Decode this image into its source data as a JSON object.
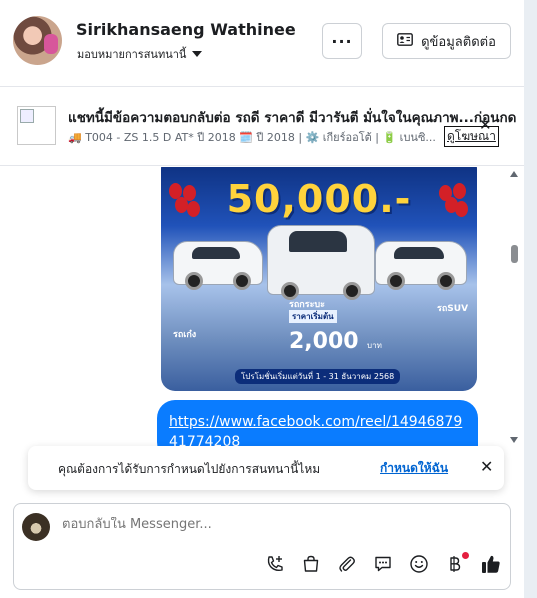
{
  "header": {
    "name": "Sirikhansaeng Wathinee",
    "assign_label": "มอบหมายการสนทนานี้",
    "more_label": "···",
    "contact_label": "ดูข้อมูลติดต่อ"
  },
  "ad": {
    "title": "แชทนี้มีข้อความตอบกลับต่อ รถดี ราคาดี มีวารันตี มั่นใจในคุณภาพ...ก่อนกด",
    "subtitle": "🚚 T004 - ZS 1.5 D AT* ปี 2018 🗓️ ปี 2018 | ⚙️ เกียร์ออโต้ | 🔋 เบนซิ...",
    "view_label": "ดูโฆษณา"
  },
  "image": {
    "price": "50,000.-",
    "cat_left": "รถเก๋ง",
    "cat_center": "รถกระบะ",
    "cat_right": "รถSUV",
    "price_sub_label": "ราคาเริ่มต้น",
    "price_small": "2,000",
    "price_unit": "บาท",
    "period": "โปรโมชั่นเริ่มแต่วันที่ 1 - 31 ธันวาคม 2568"
  },
  "message": {
    "link": "https://www.facebook.com/reel/1494687941774208"
  },
  "toast": {
    "text": "คุณต้องการได้รับการกำหนดไปยังการสนทนานี้ไหม",
    "link": "กำหนดให้ฉัน",
    "close": "✕"
  },
  "composer": {
    "placeholder": "ตอบกลับใน Messenger..."
  },
  "icons": {
    "tools": [
      "phone-plus-icon",
      "shopping-bag-icon",
      "paperclip-icon",
      "saved-reply-icon",
      "emoji-icon",
      "baht-icon",
      "like-icon"
    ]
  },
  "colors": {
    "accent": "#0a7cff",
    "link": "#0064d1",
    "notification": "#e41e3f"
  }
}
